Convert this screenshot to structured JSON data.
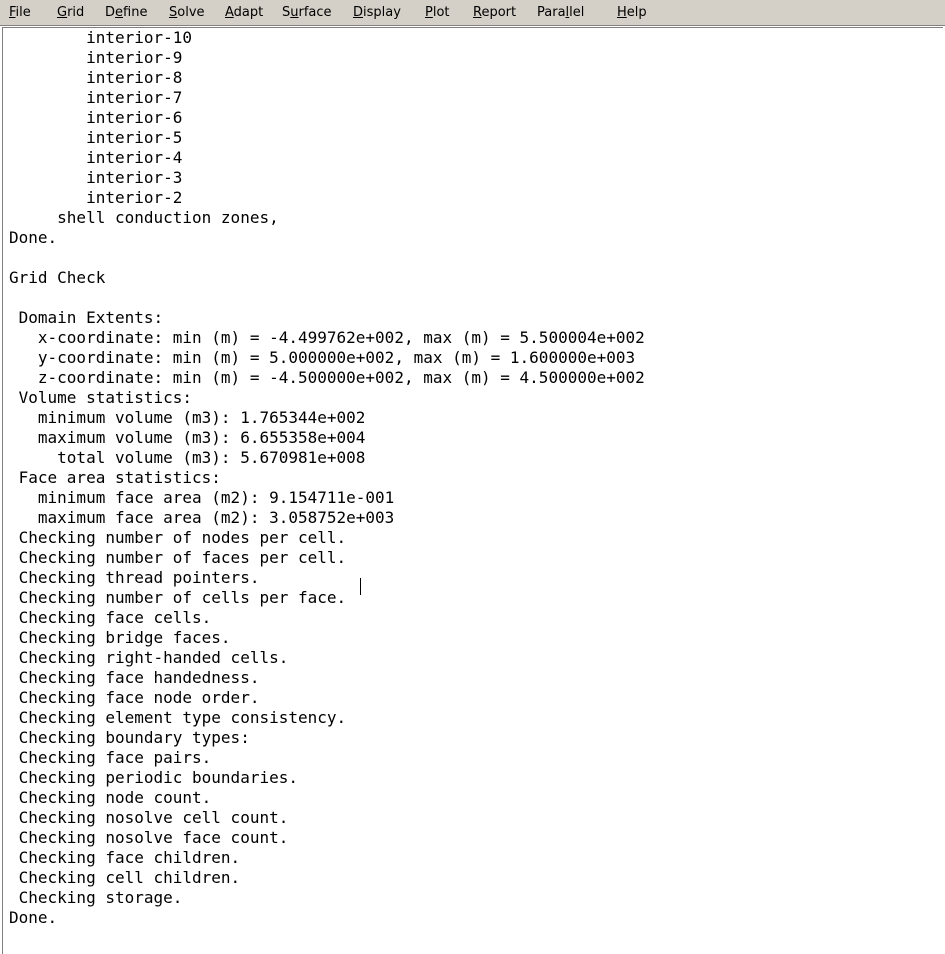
{
  "menu": [
    {
      "label": "File",
      "key": "F"
    },
    {
      "label": "Grid",
      "key": "G"
    },
    {
      "label": "Define",
      "key": "e"
    },
    {
      "label": "Solve",
      "key": "S"
    },
    {
      "label": "Adapt",
      "key": "A"
    },
    {
      "label": "Surface",
      "key": "u"
    },
    {
      "label": "Display",
      "key": "D"
    },
    {
      "label": "Plot",
      "key": "P"
    },
    {
      "label": "Report",
      "key": "R"
    },
    {
      "label": "Parallel",
      "key": "l"
    },
    {
      "label": "Help",
      "key": "H"
    }
  ],
  "console": {
    "lines": [
      "        interior-10",
      "        interior-9",
      "        interior-8",
      "        interior-7",
      "        interior-6",
      "        interior-5",
      "        interior-4",
      "        interior-3",
      "        interior-2",
      "     shell conduction zones,",
      "Done.",
      "",
      "Grid Check",
      "",
      " Domain Extents:",
      "   x-coordinate: min (m) = -4.499762e+002, max (m) = 5.500004e+002",
      "   y-coordinate: min (m) = 5.000000e+002, max (m) = 1.600000e+003",
      "   z-coordinate: min (m) = -4.500000e+002, max (m) = 4.500000e+002",
      " Volume statistics:",
      "   minimum volume (m3): 1.765344e+002",
      "   maximum volume (m3): 6.655358e+004",
      "     total volume (m3): 5.670981e+008",
      " Face area statistics:",
      "   minimum face area (m2): 9.154711e-001",
      "   maximum face area (m2): 3.058752e+003",
      " Checking number of nodes per cell.",
      " Checking number of faces per cell.",
      " Checking thread pointers.",
      " Checking number of cells per face.",
      " Checking face cells.",
      " Checking bridge faces.",
      " Checking right-handed cells.",
      " Checking face handedness.",
      " Checking face node order.",
      " Checking element type consistency.",
      " Checking boundary types:",
      " Checking face pairs.",
      " Checking periodic boundaries.",
      " Checking node count.",
      " Checking nosolve cell count.",
      " Checking nosolve face count.",
      " Checking face children.",
      " Checking cell children.",
      " Checking storage.",
      "Done."
    ]
  }
}
